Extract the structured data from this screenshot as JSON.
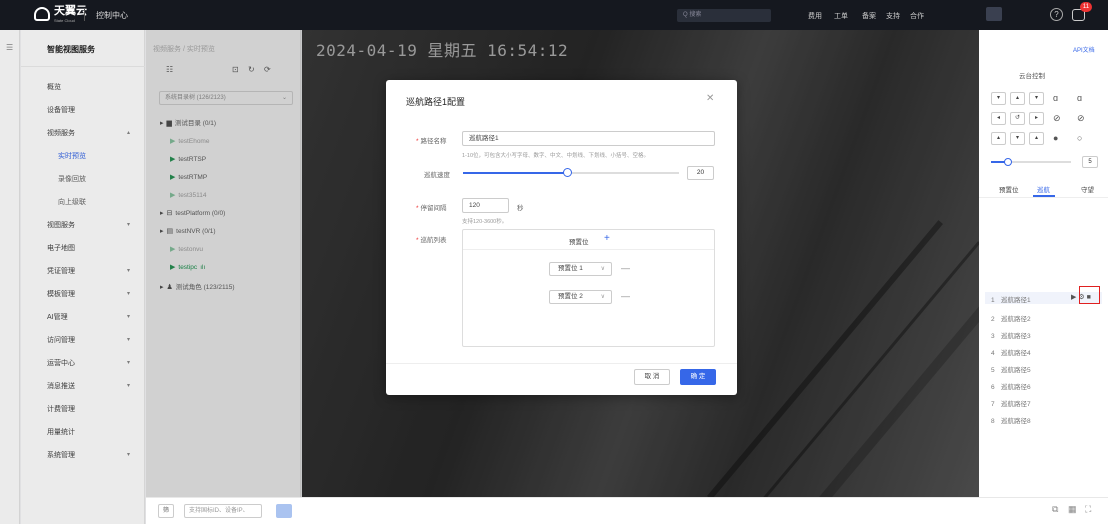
{
  "topbar": {
    "brand": "天翼云",
    "brand_sub": "State Cloud",
    "console": "控制中心",
    "search_placeholder": "Q 搜索",
    "nav": [
      "费用",
      "工单",
      "备案",
      "支持",
      "合作"
    ],
    "notification_count": "11",
    "help_icon": "question-icon"
  },
  "sidemenu": {
    "title": "智能视图服务",
    "items": [
      {
        "label": "概览"
      },
      {
        "label": "设备管理"
      },
      {
        "label": "视频服务"
      },
      {
        "label": "实时预览"
      },
      {
        "label": "录像回放"
      },
      {
        "label": "向上级联"
      },
      {
        "label": "视图服务"
      },
      {
        "label": "电子地图"
      },
      {
        "label": "凭证管理"
      },
      {
        "label": "模板管理"
      },
      {
        "label": "AI管理"
      },
      {
        "label": "访问管理"
      },
      {
        "label": "运营中心"
      },
      {
        "label": "消息推送"
      },
      {
        "label": "计费管理"
      },
      {
        "label": "用量统计"
      },
      {
        "label": "系统管理"
      }
    ],
    "active_color": "#3667e8"
  },
  "breadcrumb": "视频服务 / 实时预览",
  "tree": {
    "selector": "系统目录树 (126/2123)",
    "nodes": [
      {
        "label": "测试目录",
        "count": "(0/1)"
      },
      {
        "label": "testEhome"
      },
      {
        "label": "testRTSP"
      },
      {
        "label": "testRTMP"
      },
      {
        "label": "test35114"
      },
      {
        "label": "testPlatform",
        "count": "(0/0)"
      },
      {
        "label": "testNVR",
        "count": "(0/1)"
      },
      {
        "label": "testonvu"
      },
      {
        "label": "testipc"
      },
      {
        "label": "测试角色",
        "count": "(123/2115)"
      }
    ]
  },
  "video": {
    "osd": "2024-04-19 星期五 16:54:12"
  },
  "bottombar": {
    "filter_label": "筛",
    "input_placeholder": "支持国标ID、设备IP、"
  },
  "ptz": {
    "api_link": "API文档",
    "title": "云台控制",
    "speed": "5",
    "tabs": [
      "预置位",
      "巡航",
      "守望"
    ],
    "active_tab": "巡航",
    "cruise_list": [
      {
        "num": "1",
        "label": "巡航路径1"
      },
      {
        "num": "2",
        "label": "巡航路径2"
      },
      {
        "num": "3",
        "label": "巡航路径3"
      },
      {
        "num": "4",
        "label": "巡航路径4"
      },
      {
        "num": "5",
        "label": "巡航路径5"
      },
      {
        "num": "6",
        "label": "巡航路径6"
      },
      {
        "num": "7",
        "label": "巡航路径7"
      },
      {
        "num": "8",
        "label": "巡航路径8"
      }
    ]
  },
  "modal": {
    "title": "巡航路径1配置",
    "name_label": "路径名称",
    "name_value": "巡航路径1",
    "name_hint": "1-10位，可包含大小写字母、数字、中文、中划线、下划线、小括号、空格。",
    "speed_label": "巡航速度",
    "speed_value": "20",
    "speed_fraction": 0.5,
    "interval_label": "停留间隔",
    "interval_value": "120",
    "interval_unit": "秒",
    "interval_hint": "支持120-3600秒。",
    "list_label": "巡航列表",
    "list_header": "预置位",
    "presets": [
      "预置位 1",
      "预置位 2"
    ],
    "cancel": "取 消",
    "ok": "确 定"
  }
}
